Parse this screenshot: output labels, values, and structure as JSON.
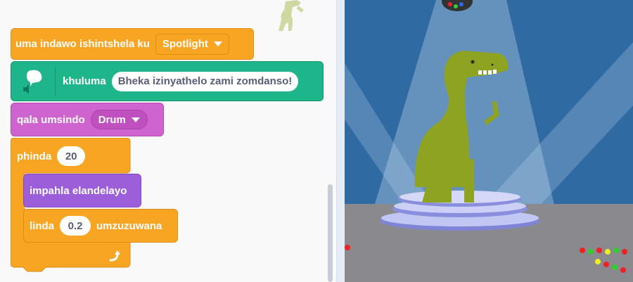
{
  "blocks": {
    "goto": {
      "label": "uma indawo ishintshela ku",
      "menu_value": "Spotlight"
    },
    "say": {
      "label": "khuluma",
      "message": "Bheka izinyathelo zami zomdanso!"
    },
    "sound": {
      "label": "qala umsindo",
      "menu_value": "Drum"
    },
    "repeat": {
      "label": "phinda",
      "count": "20"
    },
    "costume": {
      "label": "impahla elandelayo"
    },
    "wait": {
      "label": "linda",
      "seconds": "0.2",
      "unit_label": "umzuzuwana"
    }
  },
  "icons": {
    "speech": "speech-bubble-icon",
    "speaker": "speaker-icon",
    "repeat_arrow": "loop-arrow-icon",
    "dropdown": "caret-down-icon"
  },
  "colors": {
    "events_orange": "#f7a523",
    "looks_purple": "#9d5fd9",
    "sound_pink": "#cf63cf",
    "text2speech_green": "#1fb58a",
    "stage_backdrop": "#2f6aa3",
    "dino": "#8ea321"
  }
}
